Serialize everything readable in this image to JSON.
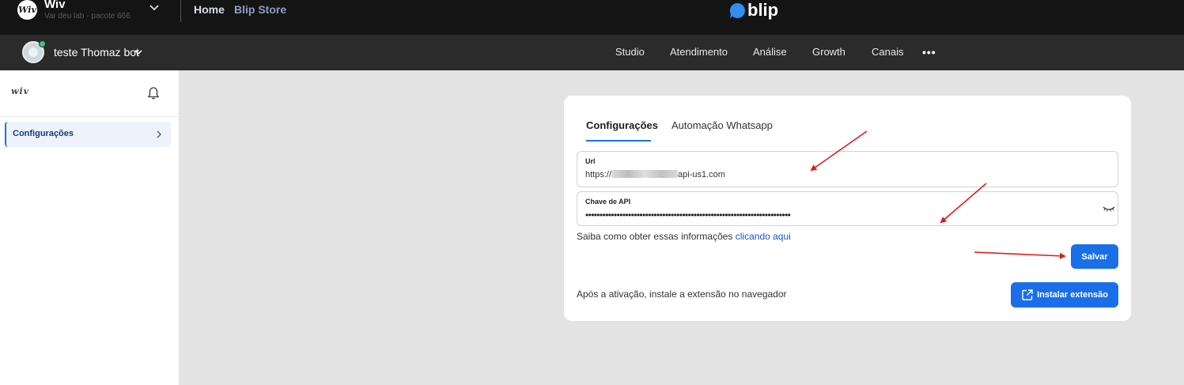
{
  "topbar": {
    "org_logo": "Wiv",
    "org_name": "Wiv",
    "org_sub": "Var deu lab - pacote 666",
    "links": {
      "home": "Home",
      "store": "Blip Store"
    },
    "brand": "blip"
  },
  "navbar": {
    "bot_name": "teste Thomaz bot",
    "items": [
      "Studio",
      "Atendimento",
      "Análise",
      "Growth",
      "Canais"
    ],
    "more": "•••"
  },
  "sidebar": {
    "logo": "wiv",
    "items": [
      {
        "label": "Configurações"
      }
    ]
  },
  "card": {
    "tabs": [
      "Configurações",
      "Automação Whatsapp"
    ],
    "url_field": {
      "label": "Url",
      "prefix": "https://",
      "suffix": "api-us1.com"
    },
    "api_field": {
      "label": "Chave de API",
      "value": "••••••••••••••••••••••••••••••••••••••••••••••••••••••••••••••••••••••••"
    },
    "help": {
      "text": "Saiba como obter essas informações ",
      "link": "clicando aqui"
    },
    "save_label": "Salvar",
    "after_text": "Após a ativação, instale a extensão no navegador",
    "install_label": "Instalar extensão"
  },
  "colors": {
    "accent": "#1a6fe8",
    "annotation": "#e01b1b",
    "online": "#3cc47a"
  }
}
